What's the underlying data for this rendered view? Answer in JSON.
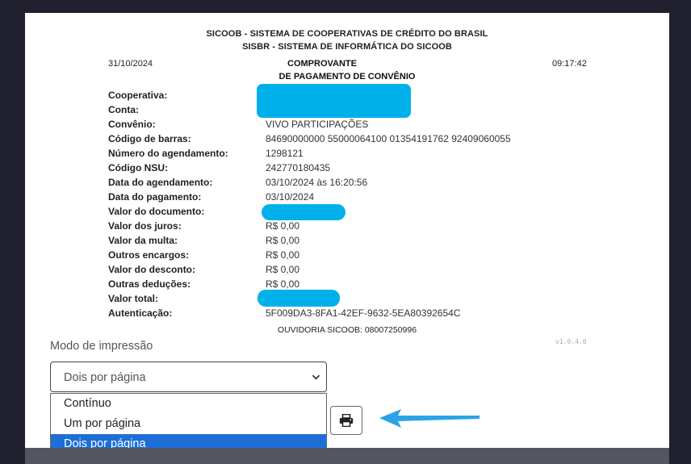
{
  "receipt": {
    "header_line1": "SICOOB - SISTEMA DE COOPERATIVAS DE CRÉDITO DO BRASIL",
    "header_line2": "SISBR - SISTEMA DE INFORMÁTICA DO SICOOB",
    "date": "31/10/2024",
    "time": "09:17:42",
    "title_line1": "COMPROVANTE",
    "title_line2": "DE PAGAMENTO DE CONVÊNIO",
    "fields": [
      {
        "label": "Cooperativa:",
        "value": ""
      },
      {
        "label": "Conta:",
        "value": ""
      },
      {
        "label": "Convênio:",
        "value": "VIVO PARTICIPAÇÕES"
      },
      {
        "label": "Código de barras:",
        "value": "84690000000 55000064100 01354191762 92409060055"
      },
      {
        "label": "Número do agendamento:",
        "value": "1298121"
      },
      {
        "label": "Código NSU:",
        "value": "242770180435"
      },
      {
        "label": "Data do agendamento:",
        "value": "03/10/2024 às 16:20:56"
      },
      {
        "label": "Data do pagamento:",
        "value": "03/10/2024"
      },
      {
        "label": "Valor do documento:",
        "value": ""
      },
      {
        "label": "Valor dos juros:",
        "value": "R$ 0,00"
      },
      {
        "label": "Valor da multa:",
        "value": "R$ 0,00"
      },
      {
        "label": "Outros encargos:",
        "value": "R$ 0,00"
      },
      {
        "label": "Valor do desconto:",
        "value": "R$ 0,00"
      },
      {
        "label": "Outras deduções:",
        "value": "R$ 0,00"
      },
      {
        "label": "Valor total:",
        "value": ""
      },
      {
        "label": "Autenticação:",
        "value": "5F009DA3-8FA1-42EF-9632-5EA80392654C"
      }
    ],
    "ouvidoria": "OUVIDORIA SICOOB: 08007250996",
    "version": "v1.0.4.0"
  },
  "print": {
    "mode_label": "Modo de impressão",
    "selected": "Dois por página",
    "options": [
      "Contínuo",
      "Um por página",
      "Dois por página"
    ],
    "selected_index": 2,
    "print_icon": "printer-icon"
  },
  "colors": {
    "redaction": "#00b0eb",
    "selection": "#1e6ed7",
    "arrow": "#2aa3e8"
  }
}
